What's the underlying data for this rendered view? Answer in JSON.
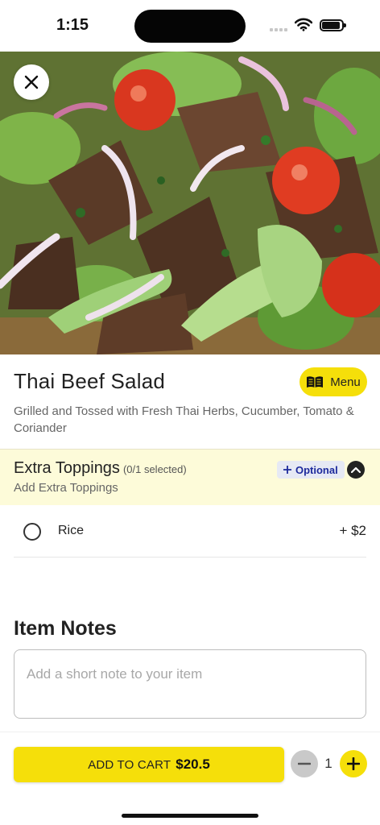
{
  "status_bar": {
    "time": "1:15",
    "icons": [
      "signal-icon",
      "wifi-icon",
      "battery-icon"
    ]
  },
  "hero": {
    "image": "thai-beef-salad-photo",
    "close_icon": "close-icon"
  },
  "item": {
    "name": "Thai Beef Salad",
    "description": "Grilled and Tossed with Fresh Thai Herbs, Cucumber, Tomato & Coriander",
    "menu_button_label": "Menu",
    "menu_icon": "book-icon"
  },
  "toppings": {
    "title": "Extra Toppings",
    "selected_count": "(0/1 selected)",
    "subtitle": "Add Extra Toppings",
    "badge": "Optional",
    "badge_icon": "plus-icon",
    "collapse_icon": "chevron-up-icon",
    "options": [
      {
        "label": "Rice",
        "price": "+ $2",
        "selected": false
      }
    ]
  },
  "notes": {
    "title": "Item Notes",
    "placeholder": "Add a short note to your item",
    "value": ""
  },
  "cart": {
    "add_label": "ADD TO CART",
    "price": "$20.5",
    "quantity": "1",
    "minus_icon": "minus-icon",
    "plus_icon": "plus-icon"
  },
  "colors": {
    "accent_yellow": "#f5df0a",
    "toppings_bg": "#fdfbd9",
    "badge_bg": "#e6e9f4",
    "badge_text": "#1d2a9c"
  }
}
